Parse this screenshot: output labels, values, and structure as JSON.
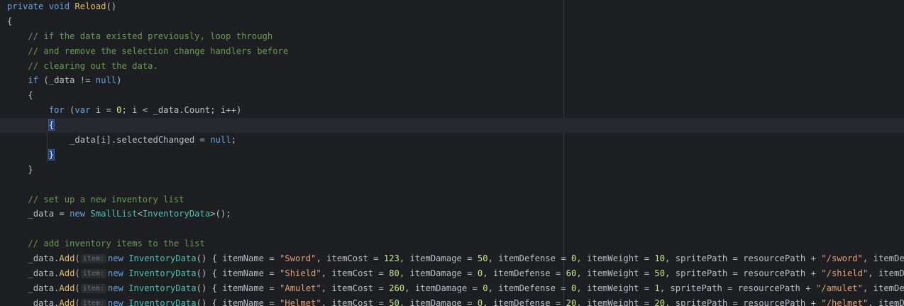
{
  "editor": {
    "colors": {
      "background": "#1e1f22",
      "current_line": "#26282e",
      "keyword": "#cf8e6d",
      "keyword_blue": "#6aa3e0",
      "method": "#e2c16b",
      "type": "#4fc1b0",
      "comment": "#6a9955",
      "string": "#e3a07b",
      "number": "#c3e88d",
      "brace_highlight": "#214283"
    },
    "lines": [
      {
        "text": "private void Reload()"
      },
      {
        "text": "{"
      },
      {
        "text": "    // if the data existed previously, loop through"
      },
      {
        "text": "    // and remove the selection change handlers before"
      },
      {
        "text": "    // clearing out the data."
      },
      {
        "text": "    if (_data != null)"
      },
      {
        "text": "    {"
      },
      {
        "text": "        for (var i = 0; i < _data.Count; i++)"
      },
      {
        "text": "        {"
      },
      {
        "text": "            _data[i].selectedChanged = null;"
      },
      {
        "text": "        }"
      },
      {
        "text": "    }"
      },
      {
        "text": ""
      },
      {
        "text": "    // set up a new inventory list"
      },
      {
        "text": "    _data = new SmallList<InventoryData>();"
      },
      {
        "text": ""
      },
      {
        "text": "    // add inventory items to the list"
      },
      {
        "text": "    _data.Add(item:new InventoryData() { itemName = \"Sword\", itemCost = 123, itemDamage = 50, itemDefense = 0, itemWeight = 10, spritePath = resourcePath + \"/sword\", itemDescription"
      },
      {
        "text": "    _data.Add(item:new InventoryData() { itemName = \"Shield\", itemCost = 80, itemDamage = 0, itemDefense = 60, itemWeight = 50, spritePath = resourcePath + \"/shield\", itemDescriptio"
      },
      {
        "text": "    _data.Add(item:new InventoryData() { itemName = \"Amulet\", itemCost = 260, itemDamage = 0, itemDefense = 0, itemWeight = 1, spritePath = resourcePath + \"/amulet\", itemDescription"
      },
      {
        "text": "    _data.Add(item:new InventoryData() { itemName = \"Helmet\", itemCost = 50, itemDamage = 0, itemDefense = 20, itemWeight = 20, spritePath = resourcePath + \"/helmet\", itemDescriptio"
      }
    ],
    "tokens": {
      "private": "private",
      "void": "void",
      "reload": "Reload",
      "parens": "()",
      "open_brace": "{",
      "close_brace": "}",
      "comment1": "// if the data existed previously, loop through",
      "comment2": "// and remove the selection change handlers before",
      "comment3": "// clearing out the data.",
      "if": "if",
      "data": "_data",
      "null": "null",
      "for": "for",
      "var": "var",
      "i": "i",
      "zero": "0",
      "count": "Count",
      "selected_changed": "selectedChanged",
      "comment4": "// set up a new inventory list",
      "new": "new",
      "small_list": "SmallList",
      "inventory_data": "InventoryData",
      "comment5": "// add inventory items to the list",
      "add": "Add",
      "hint_item": "item:",
      "item_name": "itemName",
      "item_cost": "itemCost",
      "item_damage": "itemDamage",
      "item_defense": "itemDefense",
      "item_weight": "itemWeight",
      "sprite_path": "spritePath",
      "resource_path": "resourcePath",
      "item_description": "itemDescription",
      "item_descriptio": "itemDescriptio"
    },
    "items": [
      {
        "name": "\"Sword\"",
        "cost": "123",
        "damage": "50",
        "defense": "0",
        "weight": "10",
        "sprite": "\"/sword\"",
        "tail": "itemDescription"
      },
      {
        "name": "\"Shield\"",
        "cost": "80",
        "damage": "0",
        "defense": "60",
        "weight": "50",
        "sprite": "\"/shield\"",
        "tail": "itemDescriptio"
      },
      {
        "name": "\"Amulet\"",
        "cost": "260",
        "damage": "0",
        "defense": "0",
        "weight": "1",
        "sprite": "\"/amulet\"",
        "tail": "itemDescription"
      },
      {
        "name": "\"Helmet\"",
        "cost": "50",
        "damage": "0",
        "defense": "20",
        "weight": "20",
        "sprite": "\"/helmet\"",
        "tail": "itemDescriptio"
      }
    ]
  }
}
